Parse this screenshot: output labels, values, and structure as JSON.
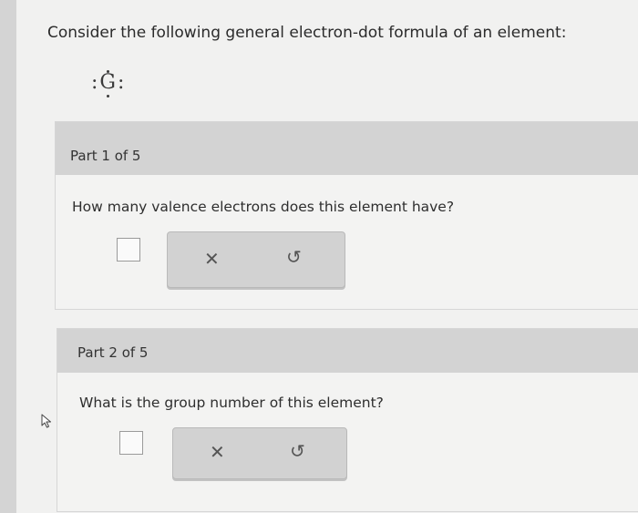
{
  "problem": {
    "prompt": "Consider the following general electron-dot formula of an element:",
    "formula_left": ":",
    "formula_symbol": "G",
    "formula_right": ":"
  },
  "parts": [
    {
      "label": "Part 1 of 5",
      "question": "How many valence electrons does this element have?",
      "answer_value": "",
      "clear_icon": "✕",
      "undo_icon": "↺"
    },
    {
      "label": "Part 2 of 5",
      "question": "What is the group number of this element?",
      "answer_value": "",
      "clear_icon": "✕",
      "undo_icon": "↺"
    }
  ],
  "icons": {
    "clear": "x-icon",
    "undo": "undo-icon",
    "cursor": "mouse-pointer-icon"
  }
}
